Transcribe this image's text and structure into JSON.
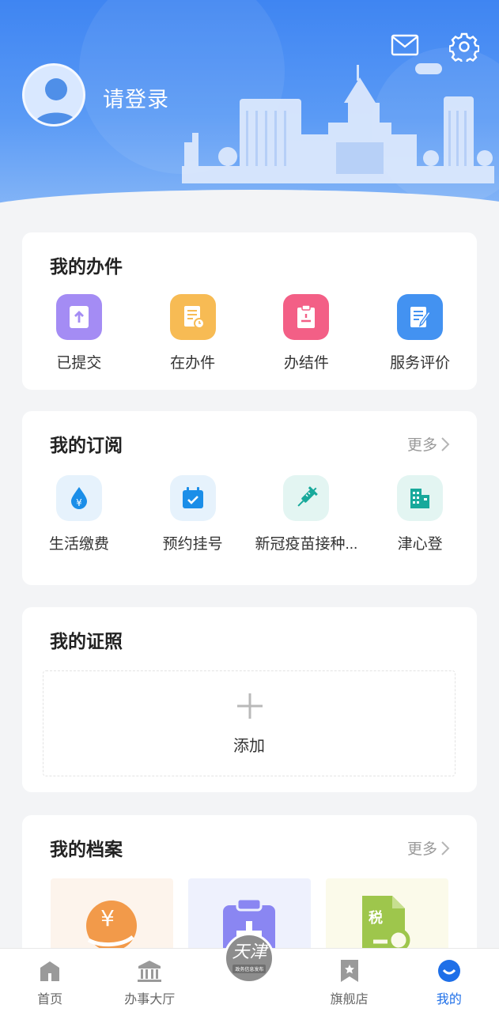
{
  "header": {
    "login_text": "请登录",
    "icons": [
      "avatar-icon",
      "mail-icon",
      "gear-icon"
    ]
  },
  "my_tasks": {
    "title": "我的办件",
    "items": [
      {
        "label": "已提交",
        "icon": "upload-document-icon",
        "color": "#a48cf4"
      },
      {
        "label": "在办件",
        "icon": "document-clock-icon",
        "color": "#f7bb54"
      },
      {
        "label": "办结件",
        "icon": "clipboard-icon",
        "color": "#f35f86"
      },
      {
        "label": "服务评价",
        "icon": "document-edit-icon",
        "color": "#4392f1"
      }
    ]
  },
  "my_subscriptions": {
    "title": "我的订阅",
    "more": "更多",
    "items": [
      {
        "label": "生活缴费",
        "icon": "water-drop-yuan-icon",
        "color": "#1b8ee8"
      },
      {
        "label": "预约挂号",
        "icon": "calendar-check-icon",
        "color": "#1b8ee8"
      },
      {
        "label": "新冠疫苗接种...",
        "icon": "syringe-icon",
        "color": "#18a99b"
      },
      {
        "label": "津心登",
        "icon": "building-icon",
        "color": "#18a99b"
      }
    ]
  },
  "my_licenses": {
    "title": "我的证照",
    "add_label": "添加"
  },
  "my_archives": {
    "title": "我的档案",
    "more": "更多",
    "tiles": [
      {
        "icon": "yuan-hand-icon",
        "color": "#f29a4a"
      },
      {
        "icon": "medical-clipboard-icon",
        "color": "#8a86f2"
      },
      {
        "icon": "tax-document-search-icon",
        "color": "#9ec64c",
        "text": "税"
      }
    ]
  },
  "bottom_nav": {
    "items": [
      {
        "label": "首页",
        "icon": "home-icon"
      },
      {
        "label": "办事大厅",
        "icon": "bank-hall-icon"
      },
      {
        "logo_text": "天津",
        "logo_sub": "政务信息发布",
        "icon": "tianjin-logo"
      },
      {
        "label": "旗舰店",
        "icon": "bookmark-star-icon"
      },
      {
        "label": "我的",
        "icon": "smile-profile-icon",
        "active": true
      }
    ],
    "active_color": "#1e6fe8"
  }
}
